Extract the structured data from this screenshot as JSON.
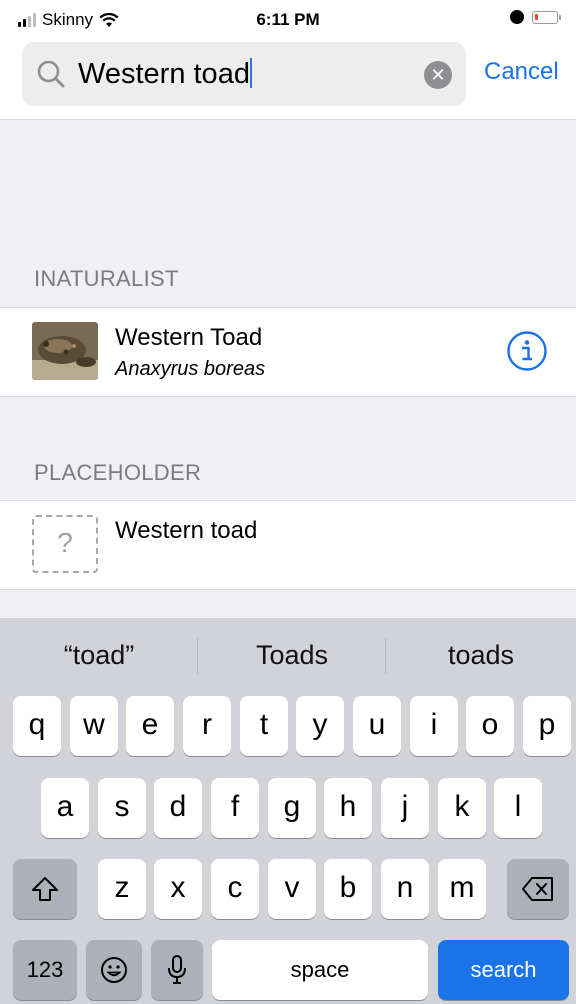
{
  "status_bar": {
    "carrier": "Skinny",
    "time": "6:11 PM"
  },
  "search": {
    "query": "Western toad",
    "cancel_label": "Cancel"
  },
  "sections": [
    {
      "header": "INATURALIST",
      "title": "Western Toad",
      "subtitle": "Anaxyrus boreas"
    },
    {
      "header": "PLACEHOLDER",
      "title": "Western toad"
    }
  ],
  "keyboard": {
    "suggestions": [
      "“toad”",
      "Toads",
      "toads"
    ],
    "row1": [
      "q",
      "w",
      "e",
      "r",
      "t",
      "y",
      "u",
      "i",
      "o",
      "p"
    ],
    "row2": [
      "a",
      "s",
      "d",
      "f",
      "g",
      "h",
      "j",
      "k",
      "l"
    ],
    "row3": [
      "z",
      "x",
      "c",
      "v",
      "b",
      "n",
      "m"
    ],
    "numbers_label": "123",
    "space_label": "space",
    "search_label": "search"
  },
  "icons": {
    "search": "search-icon",
    "clear": "clear-icon",
    "info": "info-icon",
    "placeholder": "question-mark-icon",
    "shift": "shift-icon",
    "backspace": "backspace-icon",
    "emoji": "emoji-icon",
    "microphone": "microphone-icon"
  },
  "colors": {
    "accent": "#1a73e8",
    "keyboard_bg": "#d1d3d9",
    "battery_low": "#ff3b30"
  }
}
